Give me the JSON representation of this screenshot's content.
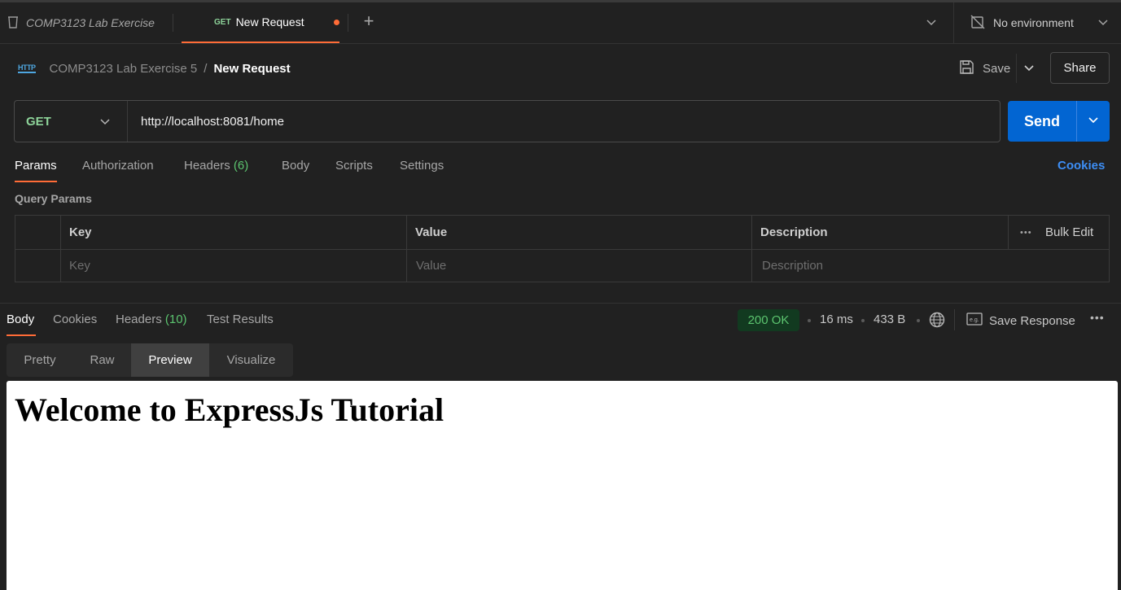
{
  "tabs": {
    "collection_tab": "COMP3123 Lab Exercise",
    "active_tab": {
      "method": "GET",
      "title": "New Request"
    }
  },
  "environment": {
    "label": "No environment"
  },
  "breadcrumb": {
    "icon_text": "HTTP",
    "parent": "COMP3123 Lab Exercise 5",
    "separator": "/",
    "current": "New Request"
  },
  "toolbar": {
    "save_label": "Save",
    "share_label": "Share"
  },
  "request": {
    "method": "GET",
    "url": "http://localhost:8081/home",
    "send_label": "Send"
  },
  "request_tabs": {
    "params": "Params",
    "authorization": "Authorization",
    "headers": "Headers",
    "headers_count": "(6)",
    "body": "Body",
    "scripts": "Scripts",
    "settings": "Settings",
    "cookies": "Cookies"
  },
  "query_params": {
    "title": "Query Params",
    "headers": {
      "key": "Key",
      "value": "Value",
      "description": "Description",
      "bulk_edit": "Bulk Edit"
    },
    "placeholders": {
      "key": "Key",
      "value": "Value",
      "description": "Description"
    }
  },
  "response_tabs": {
    "body": "Body",
    "cookies": "Cookies",
    "headers": "Headers",
    "headers_count": "(10)",
    "test_results": "Test Results"
  },
  "response_meta": {
    "status": "200 OK",
    "time": "16 ms",
    "size": "433 B",
    "save_response": "Save Response"
  },
  "view_modes": {
    "pretty": "Pretty",
    "raw": "Raw",
    "preview": "Preview",
    "visualize": "Visualize",
    "active": "Preview"
  },
  "preview": {
    "heading": "Welcome to ExpressJs Tutorial"
  },
  "colors": {
    "accent": "#ff6c37",
    "send": "#0265d2",
    "get_method": "#8ed49a",
    "status_ok": "#5cc46f",
    "link": "#3d8ef5"
  }
}
